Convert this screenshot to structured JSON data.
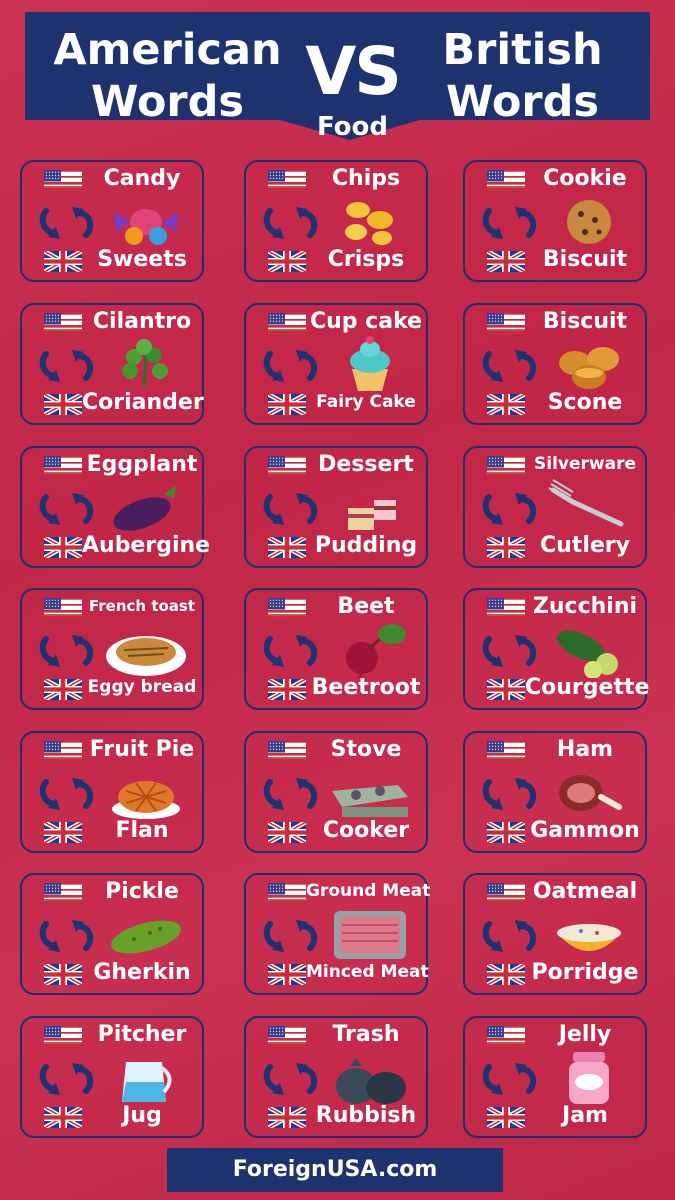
{
  "header": {
    "left_line1": "American",
    "left_line2": "Words",
    "vs": "VS",
    "right_line1": "British",
    "right_line2": "Words",
    "subtitle": "Food"
  },
  "colors": {
    "background": "#c8284b",
    "navy": "#1e3270",
    "text": "#ffffff"
  },
  "pairs": [
    {
      "american": "Candy",
      "british": "Sweets",
      "icon": "candy-icon"
    },
    {
      "american": "Chips",
      "british": "Crisps",
      "icon": "chips-icon"
    },
    {
      "american": "Cookie",
      "british": "Biscuit",
      "icon": "cookie-icon"
    },
    {
      "american": "Cilantro",
      "british": "Coriander",
      "icon": "herb-icon"
    },
    {
      "american": "Cup cake",
      "british": "Fairy Cake",
      "icon": "cupcake-icon"
    },
    {
      "american": "Biscuit",
      "british": "Scone",
      "icon": "scone-icon"
    },
    {
      "american": "Eggplant",
      "british": "Aubergine",
      "icon": "eggplant-icon"
    },
    {
      "american": "Dessert",
      "british": "Pudding",
      "icon": "cake-icon"
    },
    {
      "american": "Silverware",
      "british": "Cutlery",
      "icon": "fork-icon"
    },
    {
      "american": "French toast",
      "british": "Eggy bread",
      "icon": "french-toast-icon"
    },
    {
      "american": "Beet",
      "british": "Beetroot",
      "icon": "beet-icon"
    },
    {
      "american": "Zucchini",
      "british": "Courgette",
      "icon": "zucchini-icon"
    },
    {
      "american": "Fruit Pie",
      "british": "Flan",
      "icon": "pie-icon"
    },
    {
      "american": "Stove",
      "british": "Cooker",
      "icon": "stove-icon"
    },
    {
      "american": "Ham",
      "british": "Gammon",
      "icon": "ham-icon"
    },
    {
      "american": "Pickle",
      "british": "Gherkin",
      "icon": "pickle-icon"
    },
    {
      "american": "Ground Meat",
      "british": "Minced Meat",
      "icon": "minced-meat-icon"
    },
    {
      "american": "Oatmeal",
      "british": "Porridge",
      "icon": "porridge-icon"
    },
    {
      "american": "Pitcher",
      "british": "Jug",
      "icon": "jug-icon"
    },
    {
      "american": "Trash",
      "british": "Rubbish",
      "icon": "trash-bags-icon"
    },
    {
      "american": "Jelly",
      "british": "Jam",
      "icon": "jam-jar-icon"
    }
  ],
  "jam_label": "Jelly",
  "footer": "ForeignUSA.com"
}
